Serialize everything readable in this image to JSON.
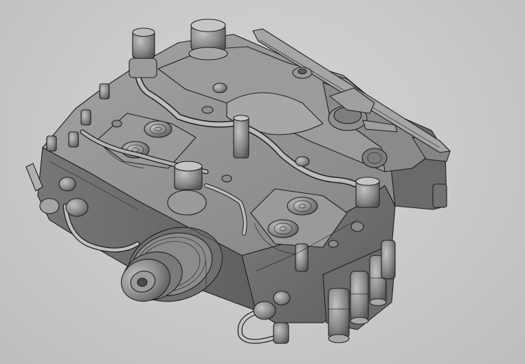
{
  "viewport": {
    "background_color": "#c9c9c9",
    "shading_colors": {
      "top_face": "#8e8e8e",
      "side_face_left": "#6c6c6c",
      "side_face_right": "#757575",
      "highlight": "#b2b2b2",
      "edge": "#1e1e1e"
    }
  },
  "model": {
    "parts": [
      "housing-block",
      "top-cover",
      "left-valve-assembly",
      "right-valve-assembly",
      "front-flange",
      "drive-shaft",
      "fuel-pipe-upper",
      "fuel-pipe-front",
      "fuel-pipe-bottom",
      "banjo-fittings",
      "connector-cluster-right",
      "rear-bracket",
      "lever-arm"
    ]
  }
}
